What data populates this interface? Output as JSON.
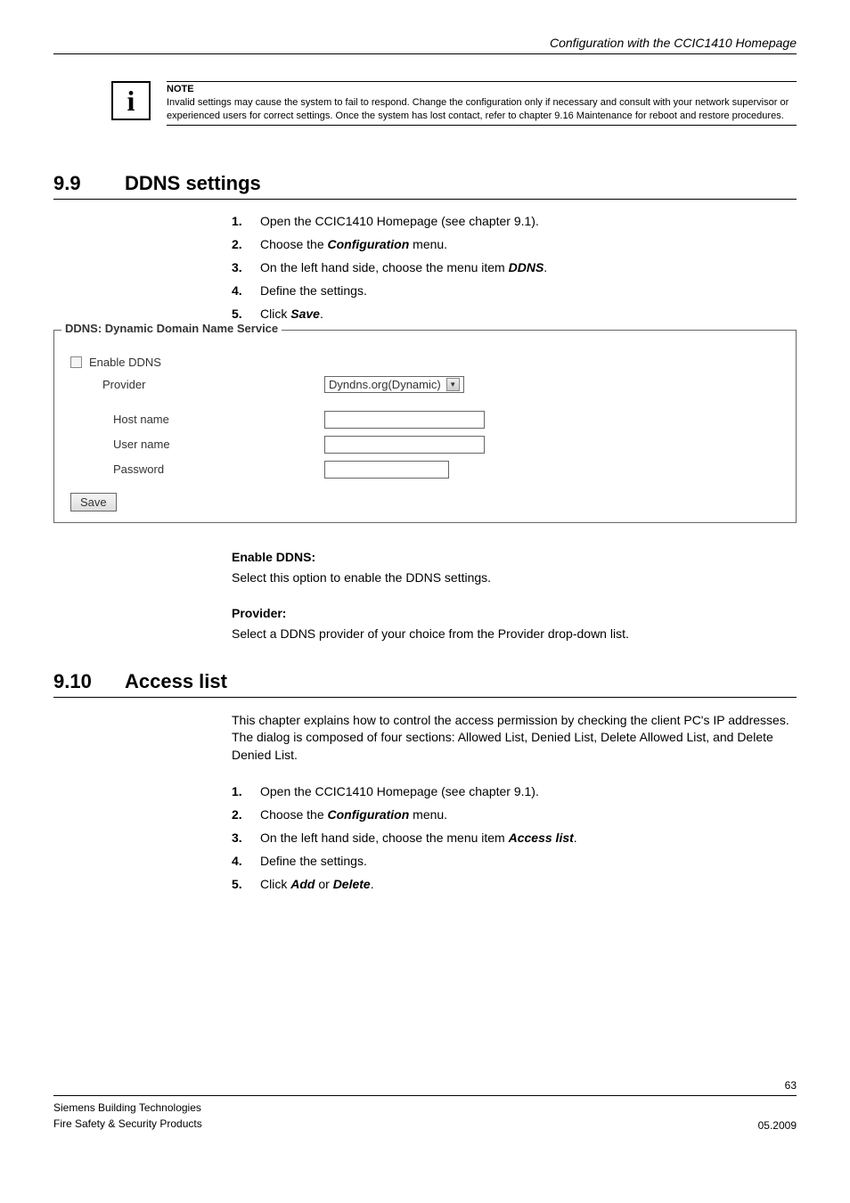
{
  "header": {
    "title": "Configuration with the CCIC1410 Homepage"
  },
  "note": {
    "title": "NOTE",
    "body": "Invalid settings may cause the system to fail to respond. Change the configuration only if necessary and consult with your network supervisor or experienced users for correct settings. Once the system has lost contact, refer to chapter 9.16 Maintenance for reboot and restore procedures."
  },
  "section1": {
    "num": "9.9",
    "title": "DDNS settings",
    "steps": [
      {
        "n": "1.",
        "t1": "Open the CCIC1410 Homepage (see chapter 9.1)."
      },
      {
        "n": "2.",
        "t1": "Choose the ",
        "b1": "Configuration",
        "t2": " menu."
      },
      {
        "n": "3.",
        "t1": "On the left hand side, choose the menu item ",
        "b1": "DDNS",
        "t2": "."
      },
      {
        "n": "4.",
        "t1": "Define the settings."
      },
      {
        "n": "5.",
        "t1": "Click ",
        "b1": "Save",
        "t2": "."
      }
    ],
    "form": {
      "legend": "DDNS: Dynamic Domain Name Service",
      "enable": "Enable DDNS",
      "provider": "Provider",
      "provider_value": "Dyndns.org(Dynamic)",
      "host": "Host name",
      "user": "User name",
      "pass": "Password",
      "save": "Save"
    },
    "subs": [
      {
        "h": "Enable DDNS:",
        "b": "Select this option to enable the DDNS settings."
      },
      {
        "h": "Provider:",
        "b": "Select a DDNS provider of your choice from the Provider drop-down list."
      }
    ]
  },
  "section2": {
    "num": "9.10",
    "title": "Access list",
    "intro": "This chapter explains how to control the access permission by checking the client PC's IP addresses. The dialog is composed of four sections: Allowed List, Denied List, Delete Allowed List, and Delete Denied List.",
    "steps": [
      {
        "n": "1.",
        "t1": "Open the CCIC1410 Homepage (see chapter 9.1)."
      },
      {
        "n": "2.",
        "t1": "Choose the ",
        "b1": "Configuration",
        "t2": " menu."
      },
      {
        "n": "3.",
        "t1": "On the left hand side, choose the menu item ",
        "b1": "Access list",
        "t2": "."
      },
      {
        "n": "4.",
        "t1": "Define the settings."
      },
      {
        "n": "5.",
        "t1": "Click ",
        "b1": "Add",
        "t2": " or ",
        "b2": "Delete",
        "t3": "."
      }
    ]
  },
  "footer": {
    "page": "63",
    "left1": "Siemens Building Technologies",
    "left2": "Fire Safety & Security Products",
    "right": "05.2009"
  }
}
